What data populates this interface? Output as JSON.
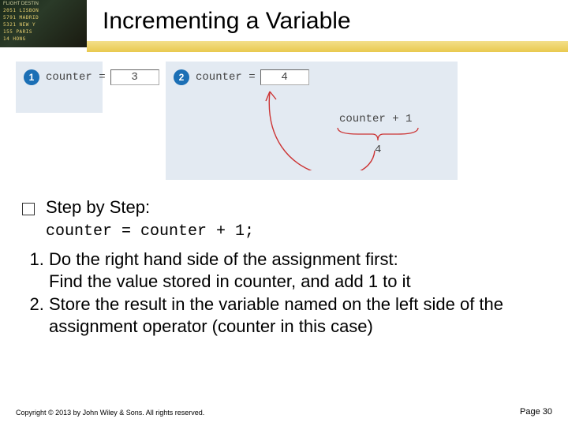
{
  "header": {
    "title": "Incrementing a Variable",
    "photo_label": "departure-board-image",
    "photo_header": "FLIGHT   DESTIN",
    "photo_rows": [
      "2051  LISBON",
      "5791  MADRID",
      "5321  NEW Y",
      "155   PARIS",
      "14    HONG"
    ]
  },
  "diagram": {
    "step1_num": "1",
    "step2_num": "2",
    "var_name_1": "counter =",
    "var_val_1": "3",
    "var_name_2": "counter =",
    "var_val_2": "4",
    "expr": "counter + 1",
    "brace_val": "4"
  },
  "body": {
    "bullet_label": "Step by Step:",
    "code": "counter = counter + 1;",
    "steps": [
      "Do the right hand side of the assignment first:\nFind the value stored in counter, and add 1 to it",
      "Store the result in the variable named on the left side of the assignment operator (counter in this case)"
    ]
  },
  "footer": {
    "copyright": "Copyright © 2013 by John Wiley & Sons. All rights reserved.",
    "page": "Page 30"
  }
}
